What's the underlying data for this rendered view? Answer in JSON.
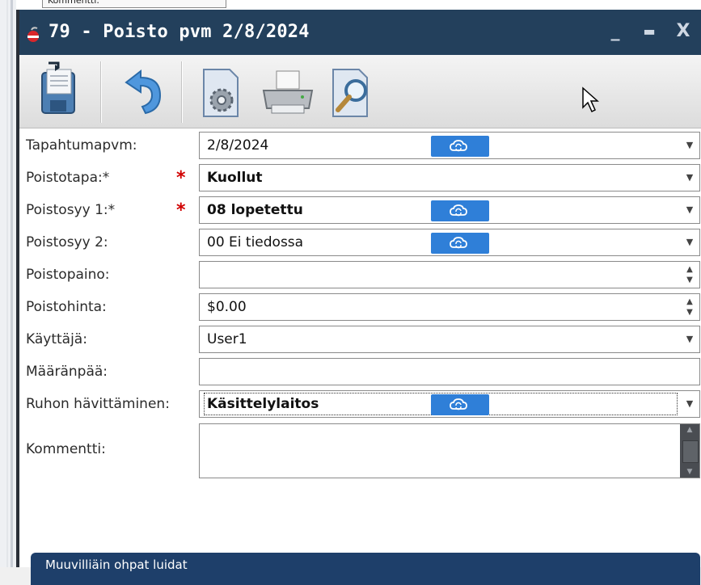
{
  "window": {
    "title": "79 - Poisto pvm 2/8/2024",
    "buttons": {
      "minimize": "_",
      "maximize": "▬",
      "close": "X"
    }
  },
  "background": {
    "partial_label": "Kommentti:"
  },
  "toolbar": {
    "items": [
      "save-icon",
      "undo-icon",
      "settings-document-icon",
      "print-icon",
      "preview-icon"
    ]
  },
  "form": {
    "fields": [
      {
        "label": "Tapahtumapvm:",
        "value": "2/8/2024",
        "required": false,
        "bold": false,
        "control": "dropdown",
        "cloud": true
      },
      {
        "label": "Poistotapa:*",
        "value": "Kuollut",
        "required": true,
        "bold": true,
        "control": "dropdown",
        "cloud": false
      },
      {
        "label": "Poistosyy 1:*",
        "value": "08 lopetettu",
        "required": true,
        "bold": true,
        "control": "dropdown",
        "cloud": true
      },
      {
        "label": "Poistosyy 2:",
        "value": "00 Ei tiedossa",
        "required": false,
        "bold": false,
        "control": "dropdown",
        "cloud": true
      },
      {
        "label": "Poistopaino:",
        "value": "",
        "required": false,
        "bold": false,
        "control": "spinner",
        "cloud": false
      },
      {
        "label": "Poistohinta:",
        "value": "$0.00",
        "required": false,
        "bold": false,
        "control": "spinner",
        "cloud": false
      },
      {
        "label": "Käyttäjä:",
        "value": "User1",
        "required": false,
        "bold": false,
        "control": "dropdown",
        "cloud": false
      },
      {
        "label": "Määränpää:",
        "value": "",
        "required": false,
        "bold": false,
        "control": "text",
        "cloud": false
      },
      {
        "label": "Ruhon hävittäminen:",
        "value": "Käsittelylaitos",
        "required": false,
        "bold": true,
        "control": "dropdown",
        "cloud": true
      },
      {
        "label": "Kommentti:",
        "value": "",
        "required": false,
        "bold": false,
        "control": "textarea",
        "cloud": false
      }
    ],
    "required_marker": "*"
  },
  "panel": {
    "label": "Muuvilliäin ohpat luidat"
  },
  "colors": {
    "titlebar": "#23405c",
    "cloud_button": "#2f7fd8",
    "required_star": "#d10000",
    "panel": "#1e3f6a"
  }
}
